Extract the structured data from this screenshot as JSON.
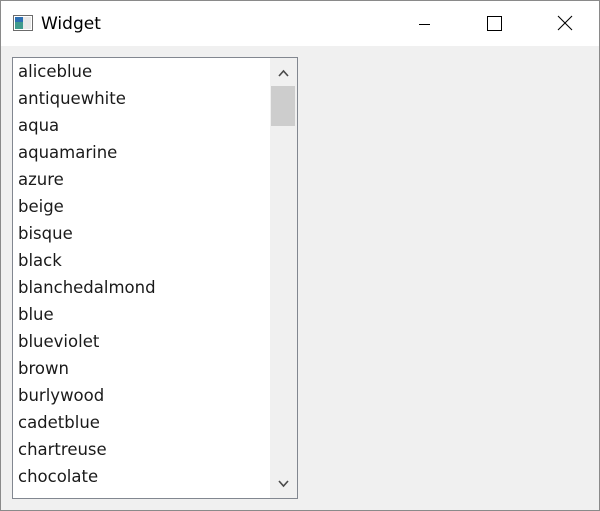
{
  "window": {
    "title": "Widget",
    "app_icon": "qt-window-icon",
    "controls": [
      "minimize-icon",
      "maximize-icon",
      "close-icon"
    ]
  },
  "list": {
    "items": [
      "aliceblue",
      "antiquewhite",
      "aqua",
      "aquamarine",
      "azure",
      "beige",
      "bisque",
      "black",
      "blanchedalmond",
      "blue",
      "blueviolet",
      "brown",
      "burlywood",
      "cadetblue",
      "chartreuse",
      "chocolate"
    ],
    "scrollbar": {
      "up_icon": "chevron-up-icon",
      "down_icon": "chevron-down-icon"
    }
  },
  "colors": {
    "window_bg": "#f0f0f0",
    "titlebar_bg": "#ffffff",
    "list_bg": "#ffffff",
    "list_border": "#828790",
    "scroll_thumb": "#cdcdcd"
  }
}
